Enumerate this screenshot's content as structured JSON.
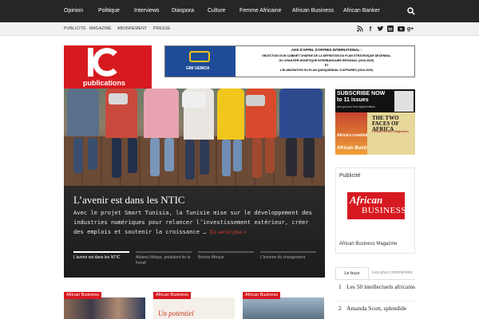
{
  "nav": {
    "items": [
      "Opinion",
      "Politique",
      "Interviews",
      "Diaspora",
      "Culture",
      "Femme Africaine",
      "African Business",
      "African Banker"
    ],
    "search_icon": "search-icon"
  },
  "subnav": {
    "items": [
      "Publicité",
      "Magazine",
      "Abonnement",
      "Presse"
    ],
    "social_icons": [
      "rss-icon",
      "facebook-icon",
      "twitter-icon",
      "linkedin-icon",
      "youtube-icon",
      "googleplus-icon"
    ]
  },
  "logo": {
    "word": "publications"
  },
  "ad": {
    "brand": "GIM UEMOA",
    "lines": [
      "AVIS D'APPEL D'OFFRES INTERNATIONAL :",
      "SELECTION D'UN CABINET CHARGE DE LA DEFINITION DU PLAN STRATEGIQUE DECENNAL",
      "DU CHANTIER MONETIQUE INTERBANCAIRE REGIONAL (2016-2025)",
      "ET",
      "L'ELABORATION DU PLAN QUINQUENNAL D'AFFAIRES (2016-2020)"
    ]
  },
  "hero": {
    "title": "L’avenir est dans les NTIC",
    "description": "Avec le projet Smart Tunisia, la Tunisie mise sur le développement des industries numériques pour relancer l’investissement extérieur, créer des emplois et soutenir la croissance …",
    "more_label": "En savoir plus »",
    "tabs": [
      "L’avenir est dans les NTIC",
      "Adama Ndiaye, président de la Fenaf",
      "Brèves Afrique",
      "L’homme du changement"
    ]
  },
  "cards": [
    {
      "tag": "African Business"
    },
    {
      "tag": "African Business",
      "img_text": "Un potentiel"
    },
    {
      "tag": "African Business"
    }
  ],
  "right_ad": {
    "headline": "SUBSCRIBE NOW to 11 issues",
    "small": "and get your free digital edition",
    "mag_label_1": "African Business",
    "mag_label_2": "Africa's creativity",
    "headline2": "THE TWO FACES OF AFRICA",
    "subline2": "Growth versus Stagnation"
  },
  "publicite": {
    "label": "Publicité",
    "logo_top": "African",
    "logo_bottom": "BUSINESS",
    "caption": "African Business Magazine"
  },
  "buzz": {
    "tabs": [
      "Le buzz",
      "Les plus commentés"
    ],
    "items": [
      {
        "num": "1",
        "text": "Les 50 intellectuels africains"
      },
      {
        "num": "2",
        "text": "Amanda Scott, splendide"
      }
    ]
  },
  "colors": {
    "brand_red": "#d71920",
    "nav_bg": "#262626",
    "link_red": "#e03b3b"
  }
}
